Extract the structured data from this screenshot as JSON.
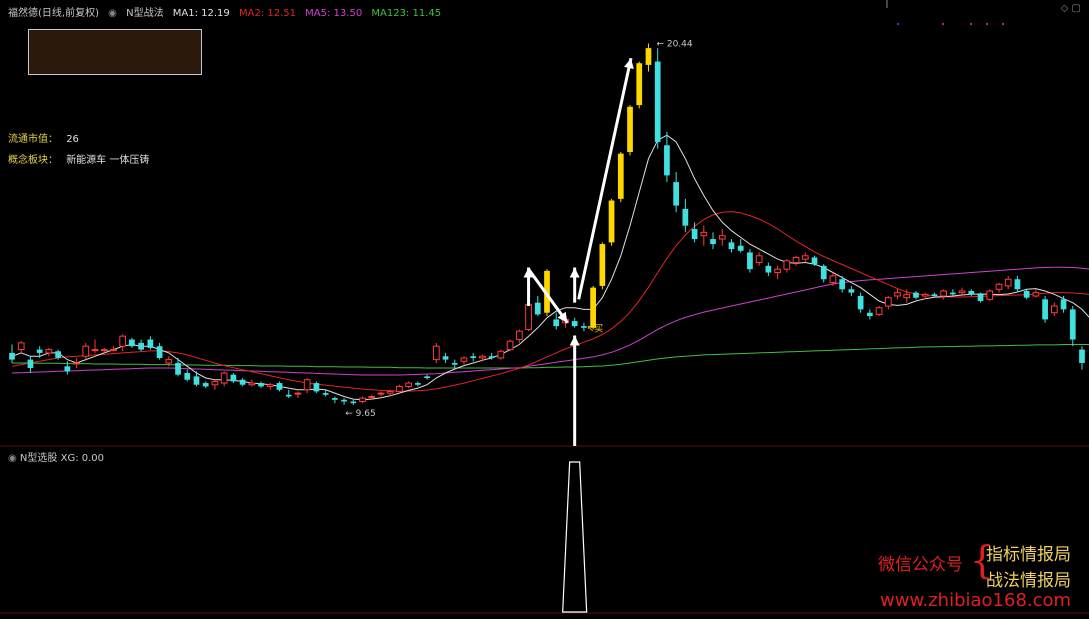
{
  "header": {
    "stock": "福然德(日线,前复权)",
    "indicator": "N型战法",
    "ma1": "MA1: 12.19",
    "ma2": "MA2: 12.51",
    "ma5": "MA5: 13.50",
    "ma123": "MA123: 11.45"
  },
  "info": {
    "float_label": "流通市值：",
    "float_value": "26",
    "concept_label": "概念板块：",
    "concept_value": "新能源车 一体压铸"
  },
  "sub": {
    "name": "N型选股",
    "value": "XG: 0.00"
  },
  "watermark": {
    "wechat": "微信公众号",
    "name1": "指标情报局",
    "name2": "战法情报局",
    "url": "www.zhibiao168.com"
  },
  "colors": {
    "up": "#ff3b3b",
    "down": "#40e0e0",
    "limit": "#ffd700",
    "ma1": "#e0e0e0",
    "ma2": "#e02424",
    "ma5": "#d040d0",
    "ma123": "#40c040",
    "arrow": "#ffffff"
  },
  "chart_data": {
    "type": "candlestick",
    "ylim": [
      8.6,
      21.2
    ],
    "price_markers": [
      {
        "label": "20.44",
        "value": 20.44
      },
      {
        "label": "9.65",
        "value": 9.65
      }
    ],
    "buy_label": "买",
    "candles": [
      [
        11.2,
        11.45,
        10.9,
        11.0
      ],
      [
        11.3,
        11.55,
        11.2,
        11.5
      ],
      [
        11.0,
        11.1,
        10.6,
        10.75
      ],
      [
        11.3,
        11.4,
        11.05,
        11.2
      ],
      [
        11.2,
        11.35,
        11.1,
        11.3
      ],
      [
        11.25,
        11.3,
        11.0,
        11.05
      ],
      [
        10.8,
        10.95,
        10.55,
        10.65
      ],
      [
        10.9,
        11.05,
        10.75,
        10.9
      ],
      [
        11.1,
        11.5,
        11.0,
        11.4
      ],
      [
        11.3,
        11.6,
        11.2,
        11.3
      ],
      [
        11.3,
        11.35,
        11.2,
        11.3
      ],
      [
        11.3,
        11.4,
        11.25,
        11.3
      ],
      [
        11.4,
        11.75,
        11.25,
        11.7
      ],
      [
        11.6,
        11.65,
        11.35,
        11.4
      ],
      [
        11.5,
        11.6,
        11.25,
        11.3
      ],
      [
        11.6,
        11.7,
        11.3,
        11.35
      ],
      [
        11.4,
        11.5,
        11.0,
        11.05
      ],
      [
        10.9,
        11.1,
        10.8,
        11.0
      ],
      [
        10.9,
        11.05,
        10.5,
        10.55
      ],
      [
        10.6,
        10.7,
        10.35,
        10.4
      ],
      [
        10.5,
        10.65,
        10.2,
        10.25
      ],
      [
        10.3,
        10.35,
        10.15,
        10.2
      ],
      [
        10.25,
        10.4,
        10.1,
        10.35
      ],
      [
        10.3,
        10.65,
        10.2,
        10.6
      ],
      [
        10.55,
        10.6,
        10.3,
        10.35
      ],
      [
        10.4,
        10.45,
        10.2,
        10.25
      ],
      [
        10.25,
        10.4,
        10.2,
        10.3
      ],
      [
        10.3,
        10.35,
        10.15,
        10.2
      ],
      [
        10.2,
        10.3,
        10.1,
        10.25
      ],
      [
        10.3,
        10.35,
        10.05,
        10.1
      ],
      [
        9.95,
        10.1,
        9.85,
        9.9
      ],
      [
        10.0,
        10.05,
        9.85,
        10.0
      ],
      [
        10.1,
        10.45,
        10.0,
        10.4
      ],
      [
        10.3,
        10.35,
        10.0,
        10.05
      ],
      [
        10.0,
        10.1,
        9.9,
        9.95
      ],
      [
        9.85,
        9.9,
        9.7,
        9.8
      ],
      [
        9.8,
        9.85,
        9.65,
        9.75
      ],
      [
        9.75,
        9.8,
        9.65,
        9.7
      ],
      [
        9.75,
        9.9,
        9.7,
        9.85
      ],
      [
        9.9,
        9.95,
        9.8,
        9.9
      ],
      [
        10.0,
        10.05,
        9.9,
        10.0
      ],
      [
        10.0,
        10.1,
        9.9,
        10.05
      ],
      [
        10.05,
        10.25,
        10.0,
        10.2
      ],
      [
        10.2,
        10.35,
        10.15,
        10.3
      ],
      [
        10.3,
        10.35,
        10.2,
        10.25
      ],
      [
        10.5,
        10.55,
        10.4,
        10.45
      ],
      [
        11.0,
        11.5,
        10.9,
        11.4
      ],
      [
        11.1,
        11.2,
        10.9,
        11.0
      ],
      [
        10.9,
        11.0,
        10.75,
        10.85
      ],
      [
        10.95,
        11.1,
        10.85,
        11.05
      ],
      [
        11.1,
        11.2,
        10.95,
        11.05
      ],
      [
        11.05,
        11.15,
        10.95,
        11.1
      ],
      [
        11.1,
        11.2,
        11.0,
        11.05
      ],
      [
        11.05,
        11.3,
        11.0,
        11.25
      ],
      [
        11.3,
        11.6,
        11.25,
        11.55
      ],
      [
        11.6,
        11.9,
        11.5,
        11.85
      ],
      [
        11.9,
        12.7,
        11.85,
        12.65
      ],
      [
        12.7,
        12.9,
        12.3,
        12.35
      ],
      [
        12.4,
        13.7,
        12.3,
        13.65
      ],
      [
        12.2,
        12.4,
        11.9,
        12.0
      ],
      [
        12.1,
        12.3,
        11.95,
        12.2
      ],
      [
        12.15,
        12.25,
        11.95,
        12.0
      ],
      [
        12.0,
        12.1,
        11.85,
        11.95
      ],
      [
        11.95,
        13.2,
        11.9,
        13.15
      ],
      [
        13.2,
        14.5,
        13.1,
        14.45
      ],
      [
        14.5,
        15.8,
        14.4,
        15.75
      ],
      [
        15.8,
        17.2,
        15.7,
        17.15
      ],
      [
        17.2,
        18.6,
        17.1,
        18.55
      ],
      [
        18.6,
        19.9,
        18.5,
        19.85
      ],
      [
        19.8,
        20.44,
        19.6,
        20.3
      ],
      [
        19.9,
        20.3,
        17.3,
        17.5
      ],
      [
        17.4,
        17.8,
        16.3,
        16.5
      ],
      [
        16.3,
        16.6,
        15.4,
        15.6
      ],
      [
        15.5,
        15.8,
        14.8,
        15.0
      ],
      [
        14.9,
        15.1,
        14.5,
        14.6
      ],
      [
        14.7,
        15.0,
        14.4,
        14.8
      ],
      [
        14.6,
        14.8,
        14.3,
        14.45
      ],
      [
        14.6,
        14.9,
        14.4,
        14.7
      ],
      [
        14.5,
        14.6,
        14.2,
        14.3
      ],
      [
        14.4,
        14.6,
        14.2,
        14.25
      ],
      [
        14.2,
        14.3,
        13.6,
        13.7
      ],
      [
        13.9,
        14.2,
        13.8,
        14.1
      ],
      [
        13.8,
        13.9,
        13.5,
        13.6
      ],
      [
        13.6,
        13.8,
        13.4,
        13.7
      ],
      [
        13.7,
        14.0,
        13.6,
        13.95
      ],
      [
        13.9,
        14.1,
        13.8,
        14.05
      ],
      [
        14.0,
        14.2,
        13.9,
        14.1
      ],
      [
        14.05,
        14.1,
        13.8,
        13.85
      ],
      [
        13.8,
        13.85,
        13.3,
        13.4
      ],
      [
        13.3,
        13.6,
        13.2,
        13.5
      ],
      [
        13.4,
        13.5,
        13.0,
        13.1
      ],
      [
        13.1,
        13.2,
        12.9,
        13.0
      ],
      [
        12.9,
        13.0,
        12.4,
        12.5
      ],
      [
        12.4,
        12.5,
        12.2,
        12.3
      ],
      [
        12.35,
        12.6,
        12.3,
        12.55
      ],
      [
        12.6,
        12.9,
        12.5,
        12.85
      ],
      [
        12.9,
        13.1,
        12.8,
        13.0
      ],
      [
        12.85,
        13.1,
        12.7,
        12.95
      ],
      [
        13.0,
        13.05,
        12.8,
        12.85
      ],
      [
        12.9,
        13.0,
        12.8,
        12.95
      ],
      [
        12.95,
        13.0,
        12.85,
        12.9
      ],
      [
        12.9,
        13.1,
        12.8,
        13.05
      ],
      [
        13.0,
        13.1,
        12.9,
        12.95
      ],
      [
        13.0,
        13.15,
        12.95,
        13.05
      ],
      [
        13.05,
        13.1,
        12.9,
        12.95
      ],
      [
        12.95,
        13.0,
        12.7,
        12.75
      ],
      [
        12.8,
        13.1,
        12.75,
        13.05
      ],
      [
        13.1,
        13.3,
        13.0,
        13.25
      ],
      [
        13.2,
        13.5,
        13.1,
        13.4
      ],
      [
        13.4,
        13.5,
        13.0,
        13.1
      ],
      [
        13.05,
        13.1,
        12.8,
        12.85
      ],
      [
        12.9,
        13.1,
        12.85,
        13.0
      ],
      [
        12.8,
        12.9,
        12.1,
        12.2
      ],
      [
        12.4,
        12.7,
        12.3,
        12.6
      ],
      [
        12.8,
        12.9,
        12.4,
        12.5
      ],
      [
        12.5,
        12.6,
        11.4,
        11.6
      ],
      [
        11.3,
        11.4,
        10.7,
        10.9
      ]
    ],
    "ma1": [
      11.1,
      11.2,
      11.1,
      11.1,
      11.2,
      11.2,
      11.0,
      10.9,
      11.0,
      11.1,
      11.2,
      11.3,
      11.4,
      11.45,
      11.4,
      11.4,
      11.3,
      11.2,
      11.0,
      10.8,
      10.6,
      10.45,
      10.4,
      10.4,
      10.38,
      10.35,
      10.3,
      10.28,
      10.25,
      10.2,
      10.15,
      10.1,
      10.1,
      10.12,
      10.1,
      10.0,
      9.9,
      9.82,
      9.8,
      9.82,
      9.86,
      9.92,
      10.0,
      10.08,
      10.15,
      10.25,
      10.45,
      10.6,
      10.72,
      10.82,
      10.9,
      10.98,
      11.05,
      11.15,
      11.3,
      11.45,
      11.7,
      11.95,
      12.25,
      12.45,
      12.55,
      12.55,
      12.5,
      12.5,
      12.85,
      13.4,
      14.1,
      15.0,
      16.0,
      17.0,
      17.55,
      17.7,
      17.5,
      17.0,
      16.4,
      15.9,
      15.45,
      15.1,
      14.85,
      14.65,
      14.45,
      14.3,
      14.15,
      14.0,
      13.9,
      13.88,
      13.9,
      13.85,
      13.75,
      13.6,
      13.45,
      13.3,
      13.15,
      12.95,
      12.75,
      12.65,
      12.62,
      12.65,
      12.75,
      12.82,
      12.86,
      12.88,
      12.9,
      12.93,
      12.95,
      12.96,
      12.95,
      12.94,
      12.96,
      13.02,
      13.1,
      13.12,
      13.05,
      12.95,
      12.82,
      12.7,
      12.5,
      12.2
    ],
    "ma2": [
      10.8,
      10.85,
      10.9,
      10.95,
      11.0,
      11.05,
      11.08,
      11.1,
      11.12,
      11.14,
      11.16,
      11.18,
      11.2,
      11.22,
      11.24,
      11.26,
      11.26,
      11.24,
      11.2,
      11.14,
      11.06,
      10.98,
      10.9,
      10.82,
      10.76,
      10.7,
      10.64,
      10.58,
      10.52,
      10.46,
      10.4,
      10.35,
      10.3,
      10.27,
      10.24,
      10.21,
      10.18,
      10.15,
      10.12,
      10.1,
      10.08,
      10.07,
      10.06,
      10.06,
      10.07,
      10.09,
      10.13,
      10.18,
      10.24,
      10.3,
      10.37,
      10.44,
      10.51,
      10.58,
      10.66,
      10.74,
      10.84,
      10.96,
      11.08,
      11.2,
      11.32,
      11.42,
      11.52,
      11.62,
      11.75,
      11.92,
      12.14,
      12.42,
      12.76,
      13.16,
      13.6,
      14.02,
      14.4,
      14.72,
      14.98,
      15.18,
      15.32,
      15.4,
      15.42,
      15.38,
      15.3,
      15.2,
      15.06,
      14.9,
      14.72,
      14.54,
      14.38,
      14.22,
      14.08,
      13.96,
      13.84,
      13.72,
      13.6,
      13.48,
      13.36,
      13.24,
      13.12,
      13.02,
      12.96,
      12.92,
      12.9,
      12.88,
      12.87,
      12.87,
      12.88,
      12.89,
      12.9,
      12.91,
      12.92,
      12.93,
      12.94,
      12.96,
      12.98,
      13.0,
      13.0,
      12.99,
      12.97,
      12.94,
      12.89,
      12.82
    ],
    "ma5": [
      10.6,
      10.61,
      10.62,
      10.63,
      10.64,
      10.65,
      10.66,
      10.67,
      10.68,
      10.69,
      10.7,
      10.71,
      10.72,
      10.73,
      10.74,
      10.75,
      10.75,
      10.75,
      10.74,
      10.73,
      10.72,
      10.71,
      10.7,
      10.69,
      10.68,
      10.67,
      10.66,
      10.65,
      10.64,
      10.63,
      10.62,
      10.61,
      10.6,
      10.59,
      10.58,
      10.57,
      10.56,
      10.55,
      10.54,
      10.54,
      10.54,
      10.54,
      10.54,
      10.55,
      10.56,
      10.57,
      10.58,
      10.6,
      10.62,
      10.64,
      10.66,
      10.68,
      10.7,
      10.72,
      10.74,
      10.76,
      10.8,
      10.84,
      10.88,
      10.92,
      10.96,
      11.0,
      11.04,
      11.08,
      11.14,
      11.22,
      11.32,
      11.44,
      11.58,
      11.74,
      11.9,
      12.04,
      12.16,
      12.26,
      12.34,
      12.42,
      12.48,
      12.54,
      12.6,
      12.66,
      12.72,
      12.78,
      12.84,
      12.9,
      12.96,
      13.02,
      13.08,
      13.14,
      13.2,
      13.26,
      13.3,
      13.33,
      13.36,
      13.38,
      13.4,
      13.42,
      13.44,
      13.46,
      13.48,
      13.5,
      13.52,
      13.54,
      13.56,
      13.58,
      13.6,
      13.62,
      13.64,
      13.66,
      13.68,
      13.7,
      13.72,
      13.74,
      13.75,
      13.76,
      13.76,
      13.75,
      13.73,
      13.7,
      13.65,
      13.5
    ],
    "ma123": [
      10.9,
      10.9,
      10.9,
      10.89,
      10.89,
      10.89,
      10.88,
      10.88,
      10.88,
      10.87,
      10.87,
      10.87,
      10.86,
      10.86,
      10.86,
      10.85,
      10.85,
      10.85,
      10.84,
      10.84,
      10.84,
      10.83,
      10.83,
      10.83,
      10.82,
      10.82,
      10.82,
      10.81,
      10.81,
      10.81,
      10.8,
      10.8,
      10.8,
      10.79,
      10.79,
      10.79,
      10.78,
      10.78,
      10.78,
      10.77,
      10.77,
      10.77,
      10.76,
      10.76,
      10.76,
      10.75,
      10.75,
      10.75,
      10.75,
      10.75,
      10.75,
      10.75,
      10.75,
      10.75,
      10.75,
      10.75,
      10.76,
      10.76,
      10.77,
      10.77,
      10.78,
      10.78,
      10.79,
      10.8,
      10.81,
      10.83,
      10.86,
      10.9,
      10.94,
      10.98,
      11.02,
      11.05,
      11.08,
      11.1,
      11.12,
      11.14,
      11.15,
      11.16,
      11.17,
      11.18,
      11.19,
      11.2,
      11.21,
      11.22,
      11.23,
      11.24,
      11.25,
      11.26,
      11.27,
      11.28,
      11.29,
      11.3,
      11.31,
      11.32,
      11.33,
      11.34,
      11.35,
      11.36,
      11.37,
      11.38,
      11.38,
      11.39,
      11.39,
      11.4,
      11.4,
      11.41,
      11.41,
      11.42,
      11.42,
      11.43,
      11.43,
      11.44,
      11.44,
      11.44,
      11.45,
      11.45,
      11.45,
      11.45,
      11.45,
      11.45
    ],
    "signal_index": 61,
    "signal_values": {
      "xg_peak": 1,
      "xg_base": 0
    }
  }
}
